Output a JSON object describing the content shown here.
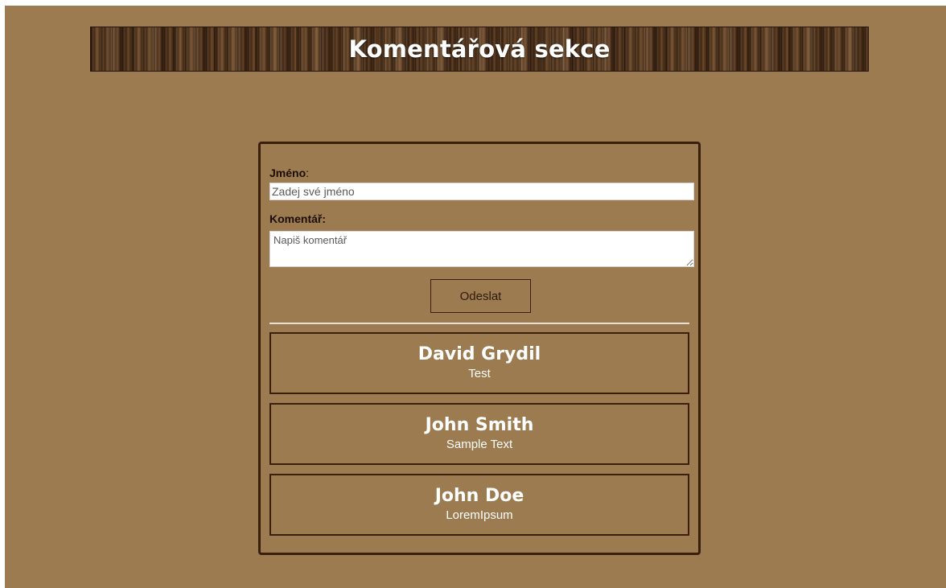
{
  "header": {
    "title": "Komentářová sekce"
  },
  "form": {
    "name_label": "Jméno",
    "name_label_suffix": ":",
    "name_placeholder": "Zadej své jméno",
    "comment_label": "Komentář:",
    "comment_placeholder": "Napiš komentář",
    "submit_label": "Odeslat"
  },
  "comments": [
    {
      "author": "David Grydil",
      "text": "Test"
    },
    {
      "author": "John Smith",
      "text": "Sample Text"
    },
    {
      "author": "John Doe",
      "text": "LoremIpsum"
    }
  ],
  "colors": {
    "background": "#9b7b4f",
    "border": "#3b1f0d",
    "banner_wood": "#4a2e17",
    "text_light": "#ffffff"
  }
}
